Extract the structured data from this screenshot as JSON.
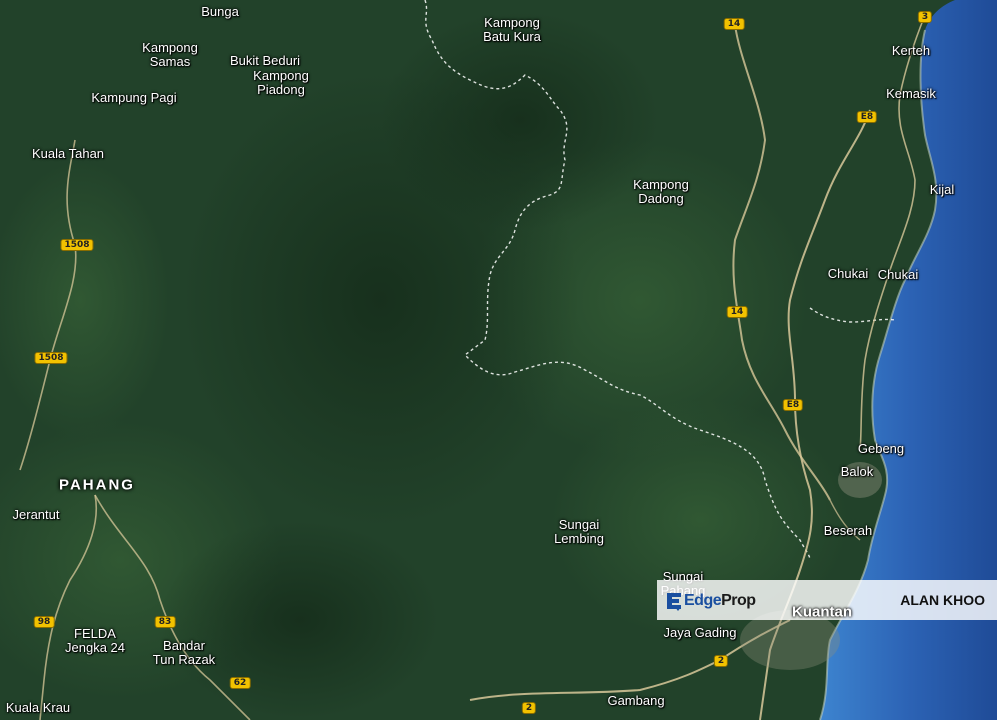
{
  "map": {
    "state_label": "PAHANG",
    "places": [
      {
        "id": "bunga",
        "name": "Bunga"
      },
      {
        "id": "kampong-samas",
        "name": "Kampong\nSamas"
      },
      {
        "id": "bukit-beduri",
        "name": "Bukit Beduri"
      },
      {
        "id": "kampong-piadong",
        "name": "Kampong\nPiadong"
      },
      {
        "id": "kampung-pagi",
        "name": "Kampung Pagi"
      },
      {
        "id": "kuala-tahan",
        "name": "Kuala Tahan"
      },
      {
        "id": "kampong-batu-kura",
        "name": "Kampong\nBatu Kura"
      },
      {
        "id": "kampong-dadong",
        "name": "Kampong\nDadong"
      },
      {
        "id": "kerteh",
        "name": "Kerteh"
      },
      {
        "id": "kemasik",
        "name": "Kemasik"
      },
      {
        "id": "kijal",
        "name": "Kijal"
      },
      {
        "id": "chukai-1",
        "name": "Chukai"
      },
      {
        "id": "chukai-2",
        "name": "Chukai"
      },
      {
        "id": "gebeng",
        "name": "Gebeng"
      },
      {
        "id": "balok",
        "name": "Balok"
      },
      {
        "id": "beserah",
        "name": "Beserah"
      },
      {
        "id": "jerantut",
        "name": "Jerantut"
      },
      {
        "id": "sungai-lembing",
        "name": "Sungai\nLembing"
      },
      {
        "id": "sungai-pahang",
        "name": "Sungai\nPahang"
      },
      {
        "id": "felda-jengka-24",
        "name": "FELDA\nJengka 24"
      },
      {
        "id": "bandar-tun-razak",
        "name": "Bandar\nTun Razak"
      },
      {
        "id": "jaya-gading",
        "name": "Jaya Gading"
      },
      {
        "id": "gambang",
        "name": "Gambang"
      },
      {
        "id": "kuala-krau",
        "name": "Kuala Krau"
      }
    ],
    "city": "Kuantan",
    "road_shields": [
      "3",
      "14",
      "E8",
      "1508",
      "1508",
      "14",
      "E8",
      "98",
      "83",
      "62",
      "2",
      "2"
    ]
  },
  "banner": {
    "logo_part1": "Edge",
    "logo_part2": "Prop",
    "agent": "ALAN KHOO"
  },
  "colors": {
    "forest": "#1f3a22",
    "sea": "#2a64b8",
    "shield": "#f2c200",
    "logo_blue": "#1a4fa0"
  }
}
